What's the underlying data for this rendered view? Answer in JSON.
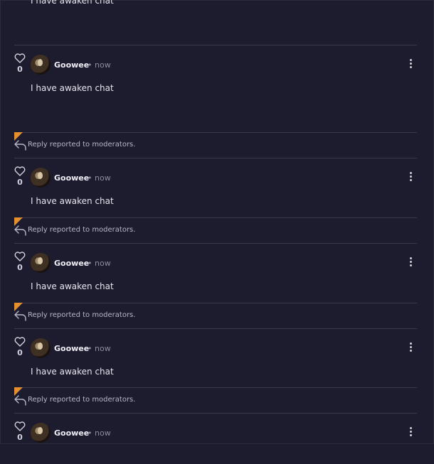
{
  "top_comment_text": "I have awaken chat",
  "comments": [
    {
      "likes": "0",
      "username": "Goowee",
      "separator": "•",
      "time": "now",
      "text": "I have awaken chat"
    },
    {
      "likes": "0",
      "username": "Goowee",
      "separator": "•",
      "time": "now",
      "text": "I have awaken chat"
    },
    {
      "likes": "0",
      "username": "Goowee",
      "separator": "•",
      "time": "now",
      "text": "I have awaken chat"
    },
    {
      "likes": "0",
      "username": "Goowee",
      "separator": "•",
      "time": "now",
      "text": "I have awaken chat"
    },
    {
      "likes": "0",
      "username": "Goowee",
      "separator": "•",
      "time": "now",
      "text": ""
    }
  ],
  "report_notice": "Reply reported to moderators.",
  "colors": {
    "background": "#1d1b2e",
    "divider": "#3a384b",
    "report_flag": "#e58e2b",
    "text": "#e7e6ef",
    "muted": "#8e8ca0"
  },
  "icons": {
    "like": "heart-icon",
    "menu": "more-options-icon",
    "reply": "reply-arrow-icon"
  }
}
